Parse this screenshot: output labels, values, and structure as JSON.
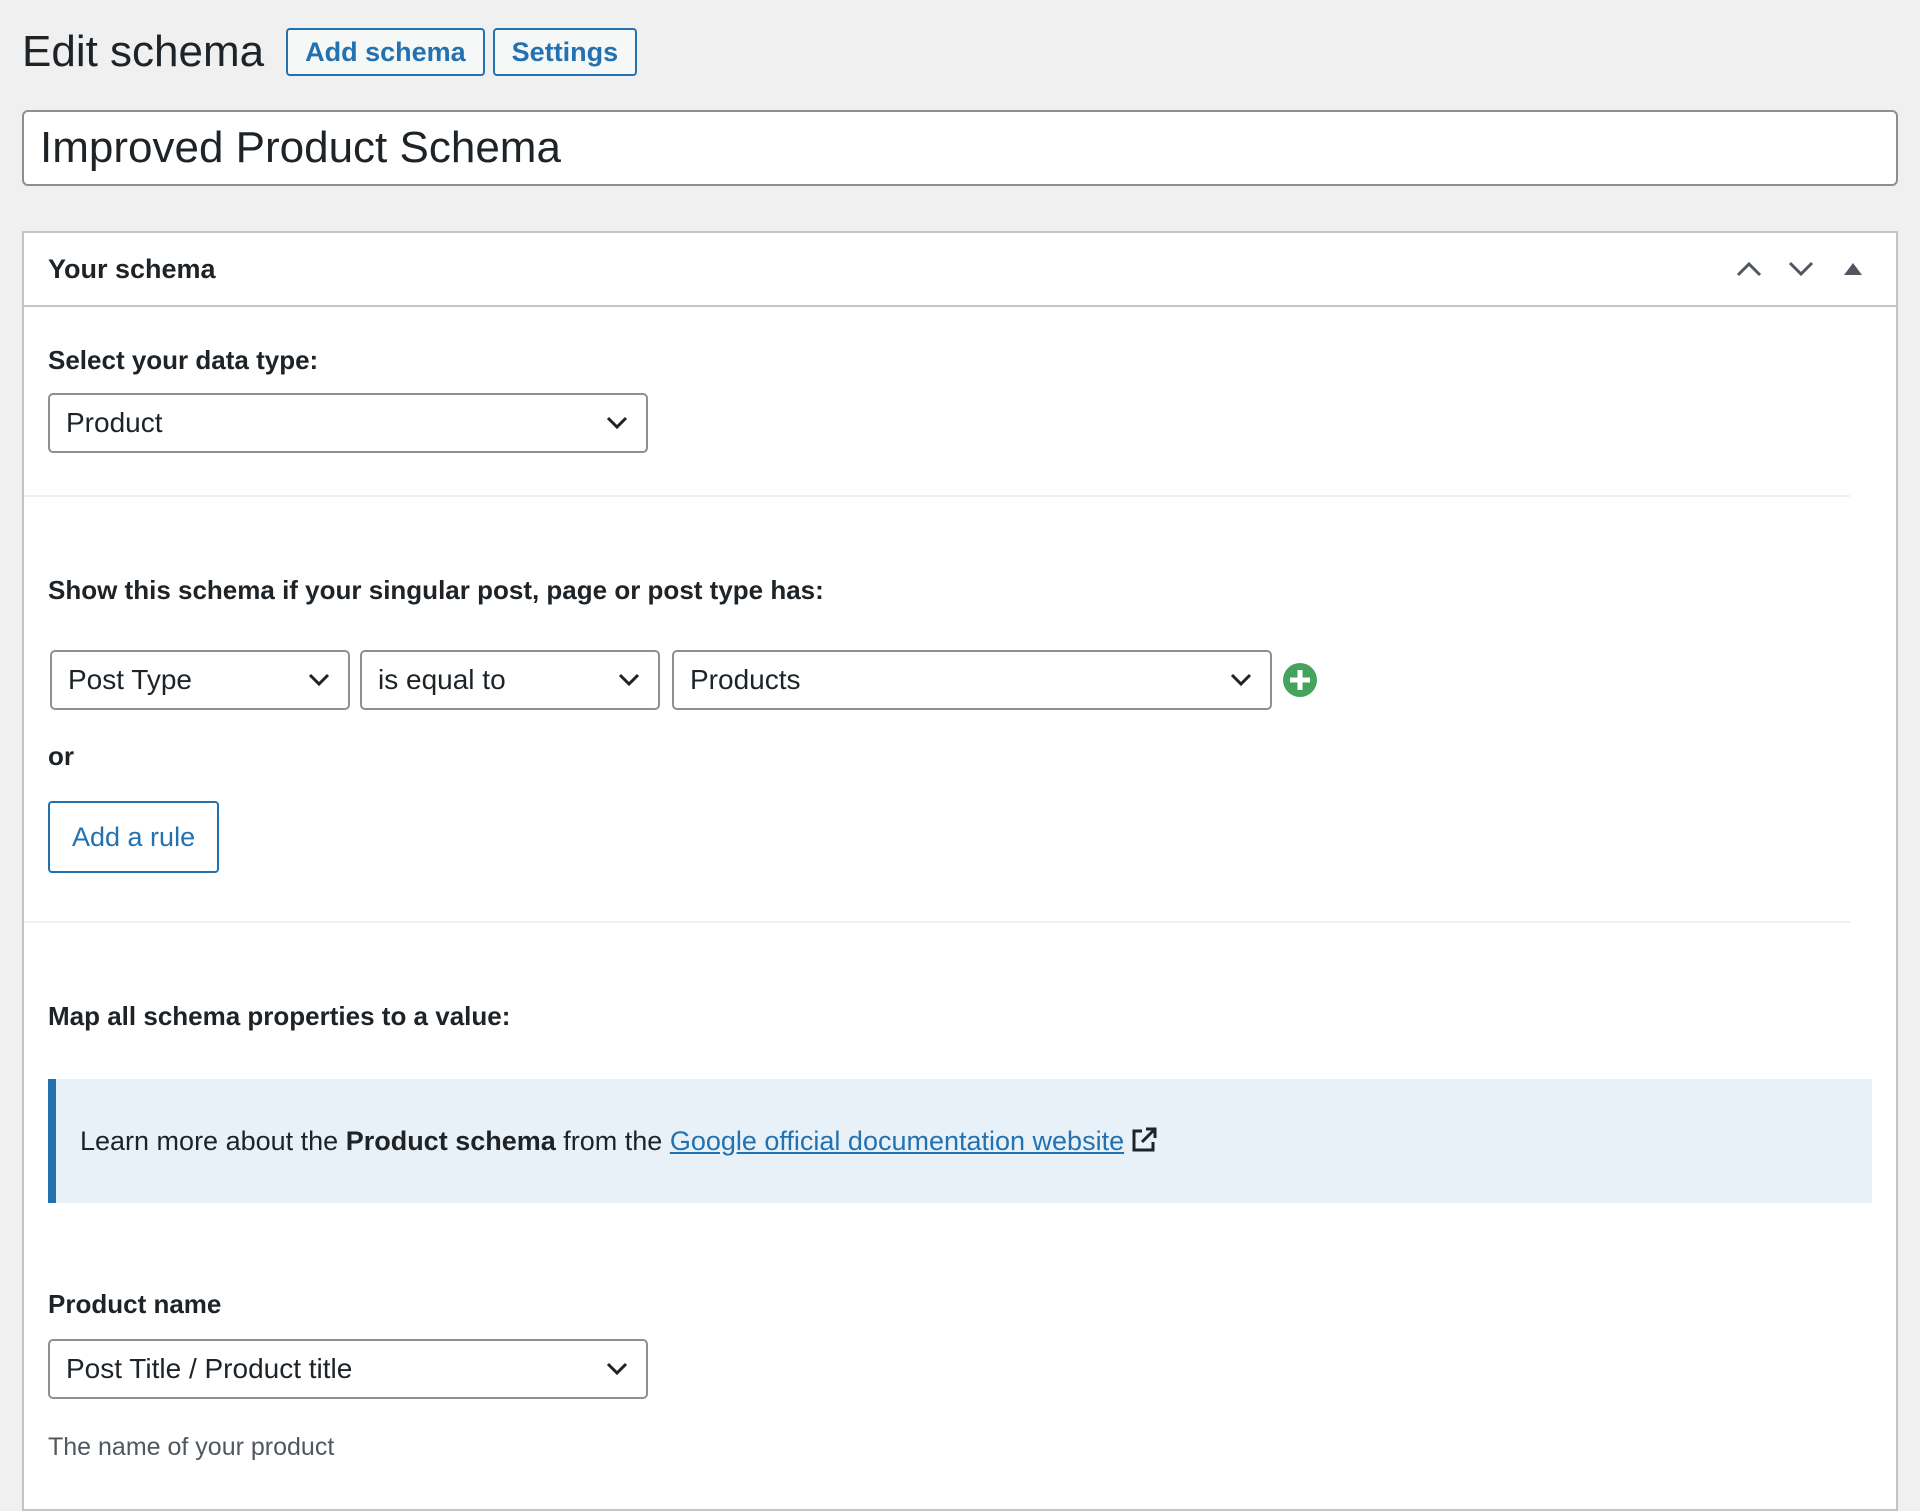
{
  "header": {
    "title": "Edit schema",
    "add_schema_label": "Add schema",
    "settings_label": "Settings"
  },
  "schema_title": "Improved Product Schema",
  "postbox": {
    "title": "Your schema",
    "icons": [
      "chevron-up-icon",
      "chevron-down-icon",
      "triangle-up-icon"
    ]
  },
  "data_type": {
    "label": "Select your data type:",
    "value": "Product"
  },
  "rules": {
    "label": "Show this schema if your singular post, page or post type has:",
    "param": "Post Type",
    "operator": "is equal to",
    "value": "Products",
    "or_label": "or",
    "add_rule_label": "Add a rule"
  },
  "mapping": {
    "label": "Map all schema properties to a value:",
    "notice_prefix": "Learn more about the ",
    "notice_bold": "Product schema",
    "notice_mid": " from the ",
    "notice_link": "Google official documentation website"
  },
  "product_name": {
    "label": "Product name",
    "value": "Post Title / Product title",
    "description": "The name of your product"
  },
  "colors": {
    "accent": "#2271b1",
    "add_green": "#46a35e",
    "notice_bg": "#e9f1f8"
  }
}
